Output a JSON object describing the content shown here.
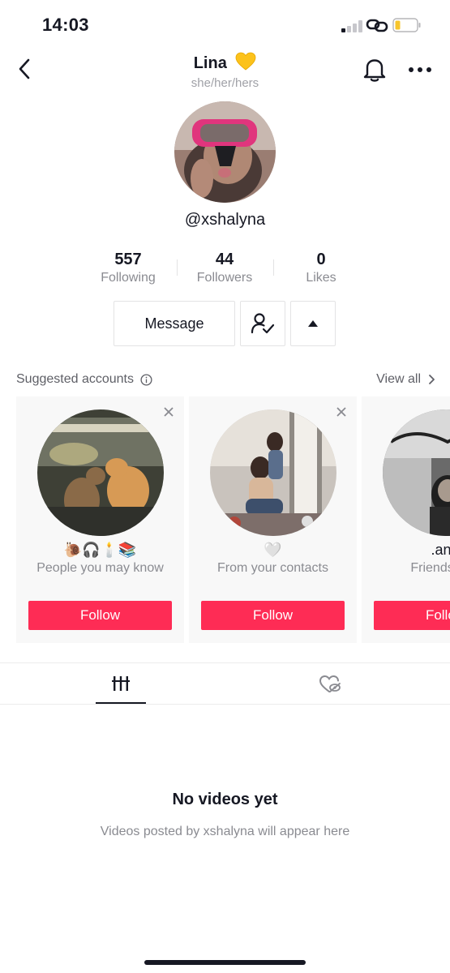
{
  "status_bar": {
    "time": "14:03",
    "icons": [
      "signal-icon",
      "link-icon",
      "battery-icon"
    ]
  },
  "header": {
    "title": "Lina",
    "title_emoji": "yellow-heart",
    "pronouns": "she/her/hers",
    "icons": [
      "back-arrow-icon",
      "bell-icon",
      "more-icon"
    ]
  },
  "profile": {
    "username": "@xshalyna"
  },
  "stats": [
    {
      "value": "557",
      "label": "Following"
    },
    {
      "value": "44",
      "label": "Followers"
    },
    {
      "value": "0",
      "label": "Likes"
    }
  ],
  "actions": {
    "message_label": "Message",
    "following_icon": "person-check-icon",
    "expand_icon": "triangle-up-icon"
  },
  "suggested": {
    "title": "Suggested accounts",
    "view_all": "View all",
    "cards": [
      {
        "name": "🐌🎧🕯️📚",
        "reason": "People you may know",
        "follow": "Follow"
      },
      {
        "name": "🤍",
        "reason": "From your contacts",
        "follow": "Follow"
      },
      {
        "name": ".an.r",
        "reason": "Friends with",
        "follow": "Follow"
      }
    ]
  },
  "tabs": [
    {
      "name": "videos",
      "icon": "grid-bars-icon",
      "active": true
    },
    {
      "name": "liked",
      "icon": "heart-hidden-icon",
      "active": false
    }
  ],
  "empty_state": {
    "title": "No videos yet",
    "subtitle": "Videos posted by xshalyna will appear here"
  },
  "colors": {
    "accent": "#fe2c55",
    "text_primary": "#161823",
    "text_secondary": "#8a8b91",
    "card_bg": "#f8f8f8"
  }
}
